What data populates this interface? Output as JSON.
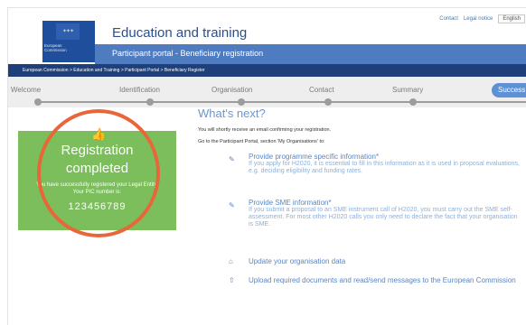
{
  "header": {
    "top_links": [
      "Contact",
      "Legal notice",
      "English"
    ],
    "logo_text": [
      "European",
      "Commission"
    ],
    "title": "Education and training",
    "subtitle": "Participant portal - Beneficiary registration",
    "breadcrumb": "European Commission > Education and Training > Participant Portal > Beneficiary Register"
  },
  "steps": {
    "labels": [
      "Welcome",
      "Identification",
      "Organisation",
      "Contact",
      "Summary"
    ],
    "success_label": "Success"
  },
  "panel": {
    "title_line1": "Registration",
    "title_line2": "completed",
    "message_line1": "You have successfully registered your Legal Entity.",
    "message_line2": "Your PIC number is:",
    "pic": "123456789"
  },
  "main": {
    "heading": "What's next?",
    "intro1": "You will shortly receive an email confirming your registration.",
    "intro2": "Go to the Participant Portal, section 'My Organisations' to:",
    "items": [
      {
        "title": "Provide programme specific information*",
        "desc": "If you apply for H2020, it is essential to fill in this information as it is used in proposal evaluations, e.g. deciding eligibility and funding rates."
      },
      {
        "title": "Provide SME information*",
        "desc": "If you submit a proposal to an SME instrument call of H2020, you must carry out the SME self-assessment. For most other H2020 calls you only need to declare the fact that your organisation is SME."
      },
      {
        "title": "Update your organisation data",
        "desc": ""
      },
      {
        "title": "Upload required documents and read/send messages to the European Commission",
        "desc": ""
      }
    ]
  },
  "icons": [
    "thumbs-up-icon",
    "pencil-icon",
    "pencil-icon",
    "home-icon",
    "upload-icon"
  ],
  "colors": {
    "panel_green": "#7bbe5b",
    "highlight_circle": "#e8673a",
    "brand_blue": "#4f7cc0",
    "link_blue": "#5a86c3"
  }
}
